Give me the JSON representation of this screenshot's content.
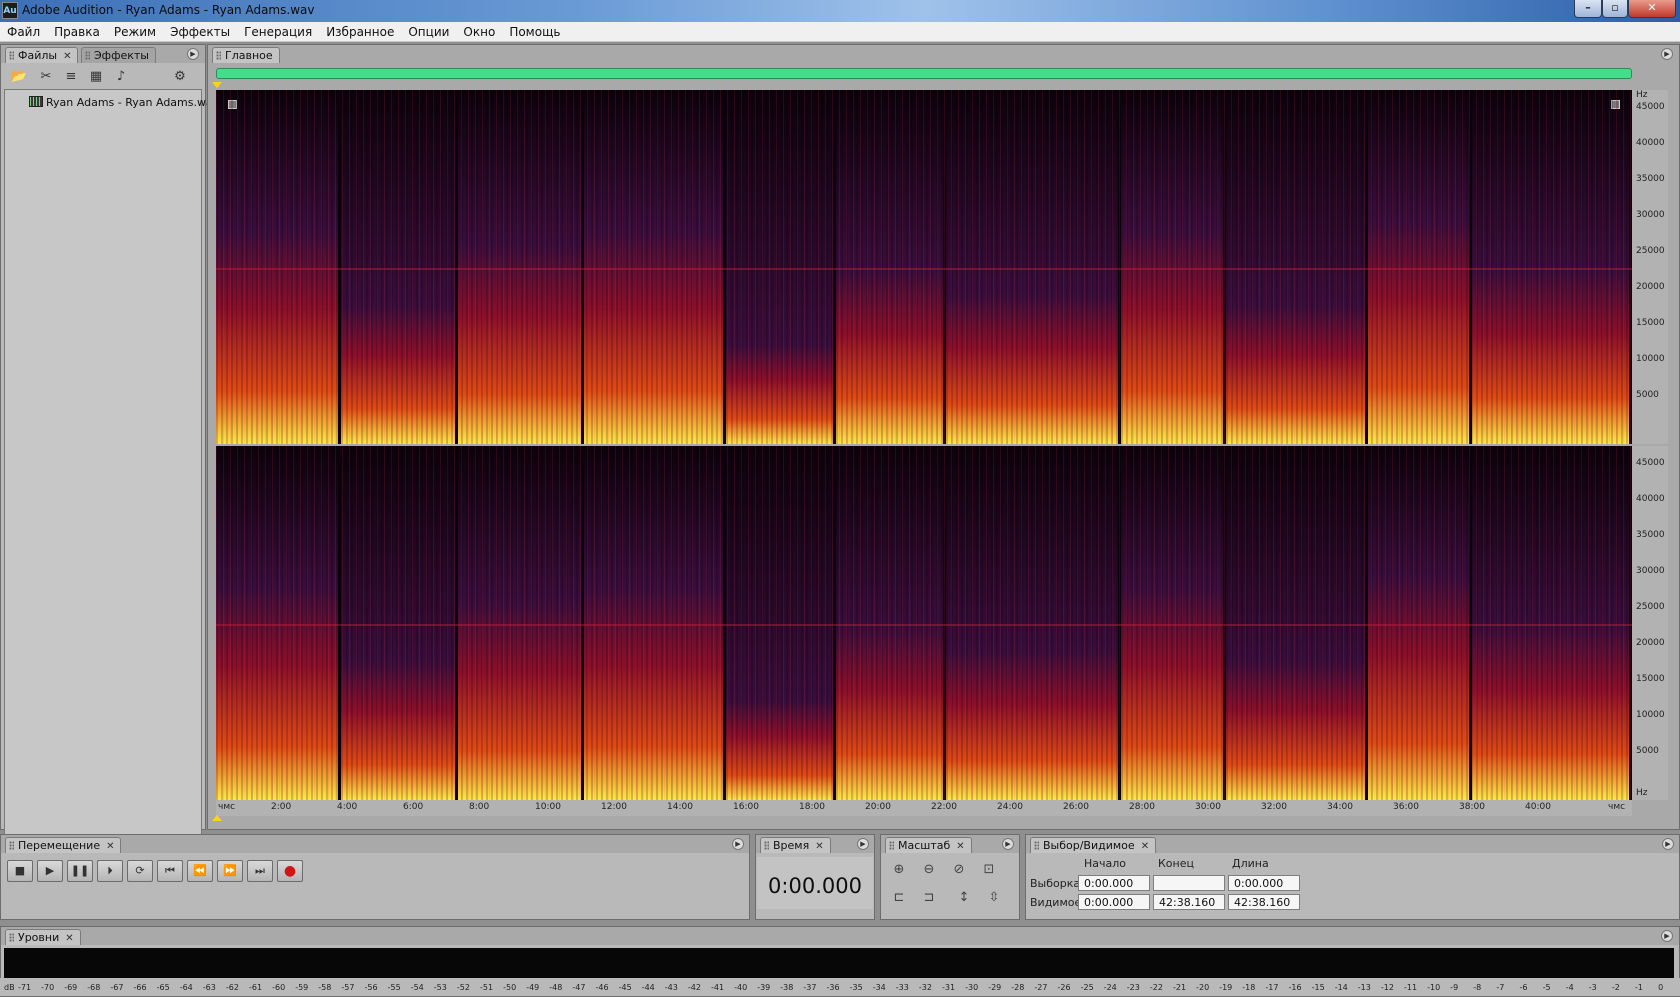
{
  "window": {
    "title": "Adobe Audition - Ryan Adams - Ryan Adams.wav",
    "app_icon": "Au",
    "controls": [
      "minimize-icon",
      "maximize-icon",
      "close-icon"
    ]
  },
  "menu": [
    "Файл",
    "Правка",
    "Режим",
    "Эффекты",
    "Генерация",
    "Избранное",
    "Опции",
    "Окно",
    "Помощь"
  ],
  "files_panel": {
    "tabs": [
      "Файлы",
      "Эффекты"
    ],
    "toolbar_icons": [
      "open-file-icon",
      "close-file-icon",
      "insert-into-multitrack-icon",
      "insert-into-cd-icon",
      "auto-play-icon",
      "show-options-icon"
    ],
    "items": [
      {
        "label": "Ryan Adams - Ryan Adams.wav",
        "icon": "wave-file-icon"
      }
    ]
  },
  "main_panel": {
    "tab": "Главное",
    "freq_unit": "Hz",
    "freq_ticks": [
      "45000",
      "40000",
      "35000",
      "30000",
      "25000",
      "20000",
      "15000",
      "10000",
      "5000"
    ],
    "time_start_label": "чмс",
    "time_end_label": "чмс",
    "time_ticks": [
      "2:00",
      "4:00",
      "6:00",
      "8:00",
      "10:00",
      "12:00",
      "14:00",
      "16:00",
      "18:00",
      "20:00",
      "22:00",
      "24:00",
      "26:00",
      "28:00",
      "30:00",
      "32:00",
      "34:00",
      "36:00",
      "38:00",
      "40:00"
    ],
    "progress_percent": 100,
    "palette": {
      "silence": "#0c020b",
      "low": "#3a0d3c",
      "mid": "#8c0f2a",
      "high": "#e04a14",
      "peak": "#ffe84a"
    }
  },
  "transport": {
    "tab": "Перемещение",
    "buttons": [
      "stop-icon",
      "play-icon",
      "pause-icon",
      "play-from-cursor-icon",
      "loop-icon",
      "go-to-start-icon",
      "rewind-icon",
      "fast-forward-icon",
      "go-to-end-icon",
      "record-icon"
    ]
  },
  "time_panel": {
    "tab": "Время",
    "value": "0:00.000"
  },
  "zoom_panel": {
    "tab": "Масштаб",
    "buttons": [
      "zoom-in-horizontal-icon",
      "zoom-out-horizontal-icon",
      "zoom-out-full-icon",
      "zoom-to-selection-icon",
      "zoom-to-left-edge-icon",
      "zoom-to-right-edge-icon",
      "zoom-in-vertical-icon",
      "zoom-out-vertical-icon"
    ]
  },
  "selection_panel": {
    "tab": "Выбор/Видимое",
    "col_start": "Начало",
    "col_end": "Конец",
    "col_length": "Длина",
    "row_selection": "Выборка",
    "row_visible": "Видимое",
    "selection": {
      "start": "0:00.000",
      "end": "",
      "length": "0:00.000"
    },
    "visible": {
      "start": "0:00.000",
      "end": "42:38.160",
      "length": "42:38.160"
    }
  },
  "levels_panel": {
    "tab": "Уровни",
    "unit": "dB",
    "ticks": [
      "-71",
      "-70",
      "-69",
      "-68",
      "-67",
      "-66",
      "-65",
      "-64",
      "-63",
      "-62",
      "-61",
      "-60",
      "-59",
      "-58",
      "-57",
      "-56",
      "-55",
      "-54",
      "-53",
      "-52",
      "-51",
      "-50",
      "-49",
      "-48",
      "-47",
      "-46",
      "-45",
      "-44",
      "-43",
      "-42",
      "-41",
      "-40",
      "-39",
      "-38",
      "-37",
      "-36",
      "-35",
      "-34",
      "-33",
      "-32",
      "-31",
      "-30",
      "-29",
      "-28",
      "-27",
      "-26",
      "-25",
      "-24",
      "-23",
      "-22",
      "-21",
      "-20",
      "-19",
      "-18",
      "-17",
      "-16",
      "-15",
      "-14",
      "-13",
      "-12",
      "-11",
      "-10",
      "-9",
      "-8",
      "-7",
      "-6",
      "-5",
      "-4",
      "-3",
      "-2",
      "-1",
      "0"
    ]
  }
}
